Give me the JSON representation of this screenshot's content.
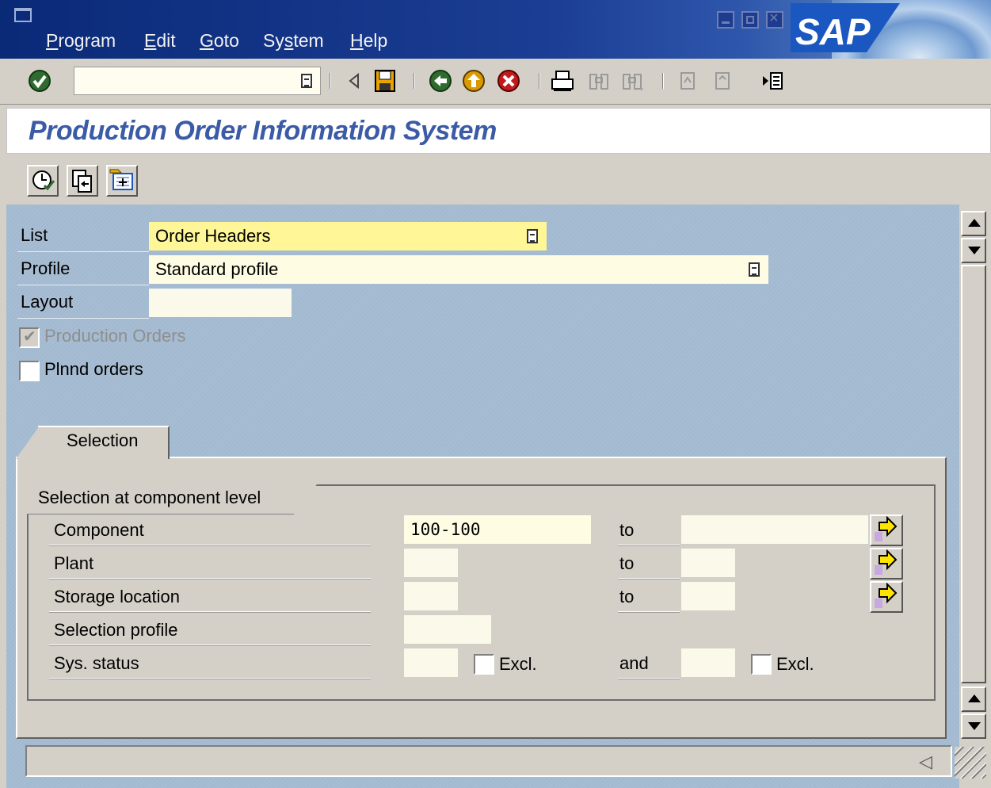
{
  "menu": {
    "items": [
      {
        "prefix": "",
        "key": "P",
        "rest": "rogram"
      },
      {
        "prefix": "",
        "key": "E",
        "rest": "dit"
      },
      {
        "prefix": "",
        "key": "G",
        "rest": "oto"
      },
      {
        "prefix": "Sy",
        "key": "s",
        "rest": "tem"
      },
      {
        "prefix": "",
        "key": "H",
        "rest": "elp"
      }
    ]
  },
  "brand": {
    "logo_text": "SAP",
    "logo_color": "#ffffff"
  },
  "system_toolbar": {
    "command_field_value": "",
    "icons": [
      "enter-icon",
      "back-arrow-icon",
      "save-icon",
      "back-icon",
      "exit-icon",
      "cancel-icon",
      "print-icon",
      "find-icon",
      "find-next-icon",
      "first-page-icon",
      "prev-page-icon",
      "customize-layout-icon"
    ]
  },
  "screen": {
    "title": "Production Order Information System",
    "title_color": "#3b5ba6"
  },
  "app_toolbar": {
    "icons": [
      "execute-icon",
      "copy-icon",
      "more-settings-icon"
    ]
  },
  "header_fields": {
    "list": {
      "label": "List",
      "value": "Order Headers"
    },
    "profile": {
      "label": "Profile",
      "value": "Standard profile"
    },
    "layout": {
      "label": "Layout",
      "value": ""
    },
    "production_orders": {
      "label": "Production Orders",
      "checked": true,
      "disabled": true
    },
    "planned_orders": {
      "label": "Plnnd orders",
      "checked": false
    }
  },
  "tabs": [
    {
      "label": "Selection",
      "active": true
    }
  ],
  "selection_group": {
    "title": "Selection at component level",
    "rows": [
      {
        "label": "Component",
        "from": "100-100",
        "to_label": "to",
        "to": "",
        "has_multi": true
      },
      {
        "label": "Plant",
        "from": "",
        "to_label": "to",
        "to": "",
        "has_multi": true
      },
      {
        "label": "Storage location",
        "from": "",
        "to_label": "to",
        "to": "",
        "has_multi": true
      },
      {
        "label": "Selection profile",
        "from": ""
      },
      {
        "label": "Sys. status",
        "from": "",
        "excl1_label": "Excl.",
        "and_label": "and",
        "to": "",
        "excl2_label": "Excl."
      }
    ]
  },
  "status_bar": {
    "text": ""
  }
}
